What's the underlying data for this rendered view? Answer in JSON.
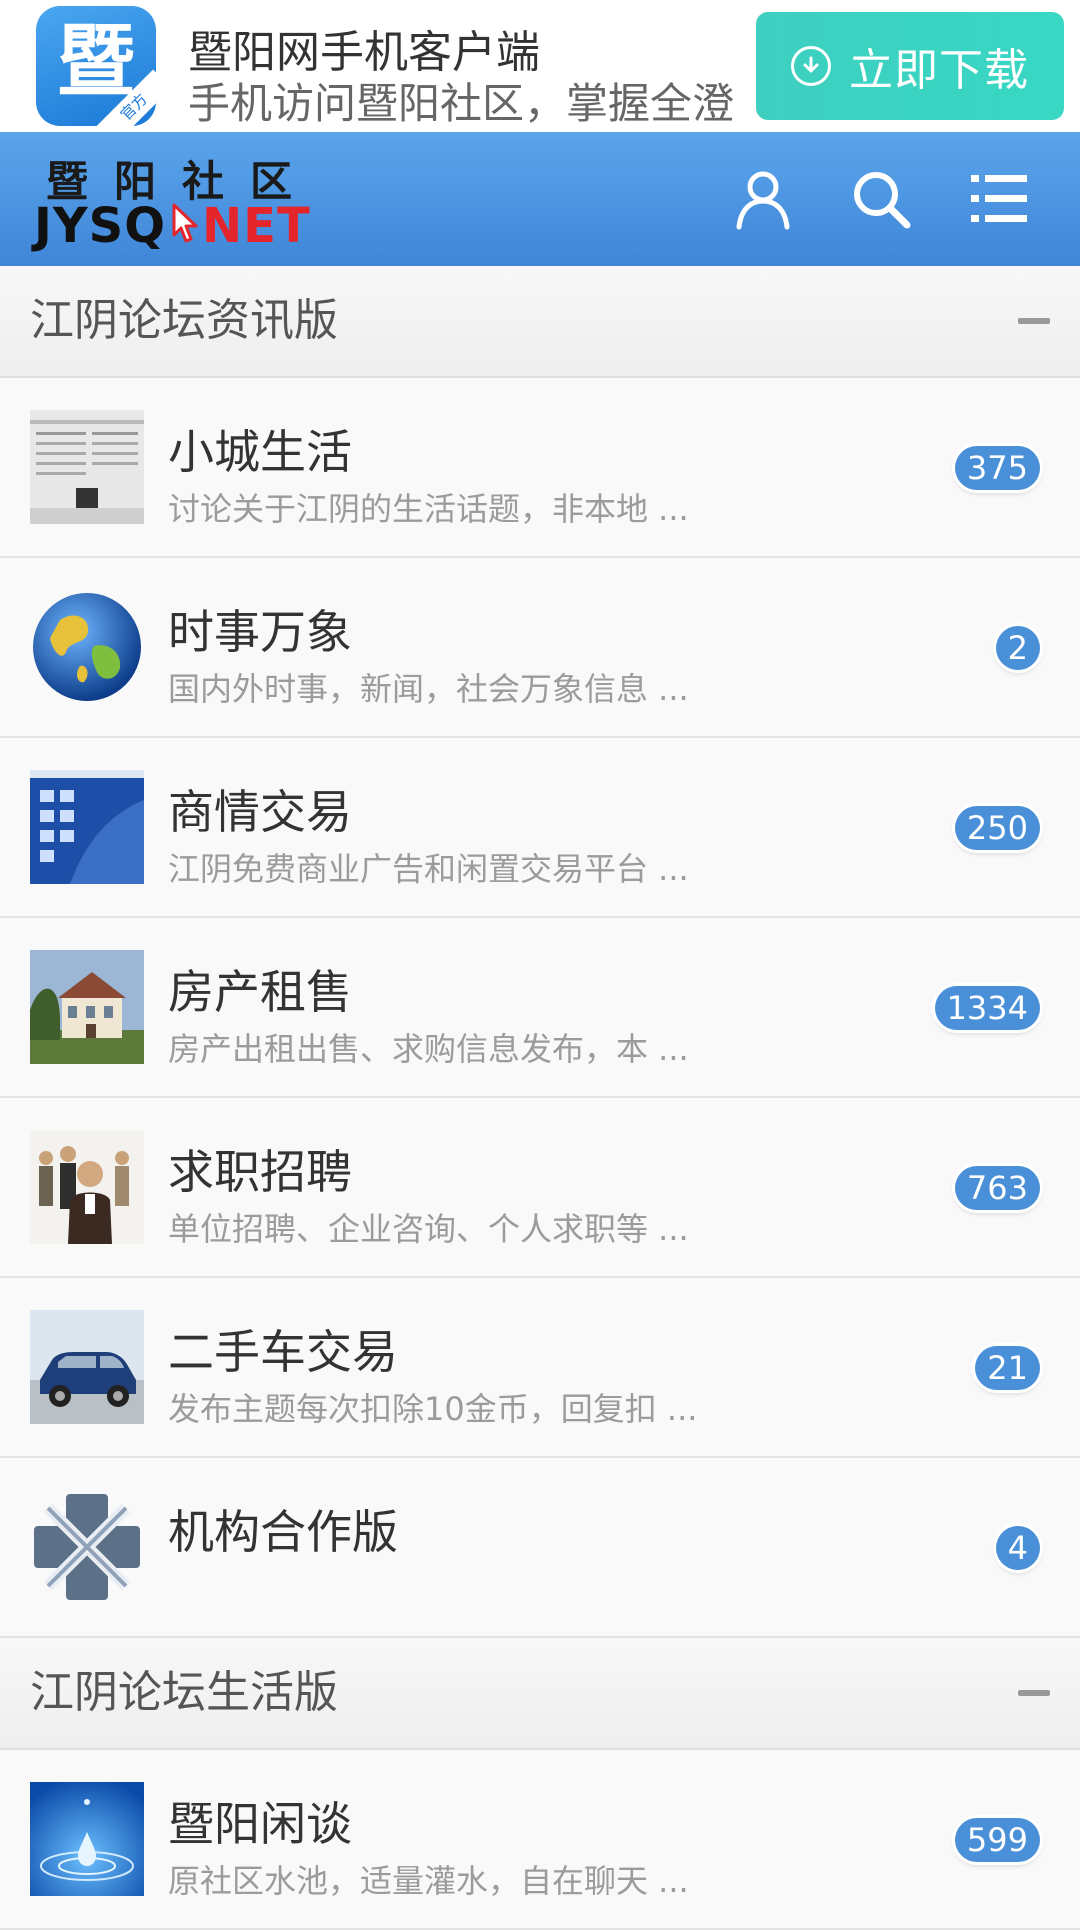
{
  "app_banner": {
    "logo_char": "暨",
    "logo_badge": "官方",
    "title": "暨阳网手机客户端",
    "subtitle": "手机访问暨阳社区，掌握全澄",
    "download_label": "立即下载"
  },
  "header": {
    "logo_cn": "暨阳社区",
    "logo_en_prefix": "JYSQ",
    "logo_en_suffix": "NET"
  },
  "sections": [
    {
      "title": "江阴论坛资讯版",
      "forums": [
        {
          "name": "小城生活",
          "desc": "讨论关于江阴的生活话题，非本地 ...",
          "count": "375",
          "icon": "newspaper-icon"
        },
        {
          "name": "时事万象",
          "desc": "国内外时事，新闻，社会万象信息 ...",
          "count": "2",
          "icon": "globe-icon"
        },
        {
          "name": "商情交易",
          "desc": "江阴免费商业广告和闲置交易平台 ...",
          "count": "250",
          "icon": "desktop-icon"
        },
        {
          "name": "房产租售",
          "desc": "房产出租出售、求购信息发布，本 ...",
          "count": "1334",
          "icon": "house-icon"
        },
        {
          "name": "求职招聘",
          "desc": "单位招聘、企业咨询、个人求职等 ...",
          "count": "763",
          "icon": "people-icon"
        },
        {
          "name": "二手车交易",
          "desc": "发布主题每次扣除10金币，回复扣 ...",
          "count": "21",
          "icon": "car-icon"
        },
        {
          "name": "机构合作版",
          "desc": "",
          "count": "4",
          "icon": "partnership-icon"
        }
      ]
    },
    {
      "title": "江阴论坛生活版",
      "forums": [
        {
          "name": "暨阳闲谈",
          "desc": "原社区水池，适量灌水，自在聊天 ...",
          "count": "599",
          "icon": "water-drop-icon"
        }
      ]
    }
  ],
  "colors": {
    "header_blue": "#4a93de",
    "download_green": "#3ed2c2",
    "badge_blue": "#4a90d9"
  }
}
